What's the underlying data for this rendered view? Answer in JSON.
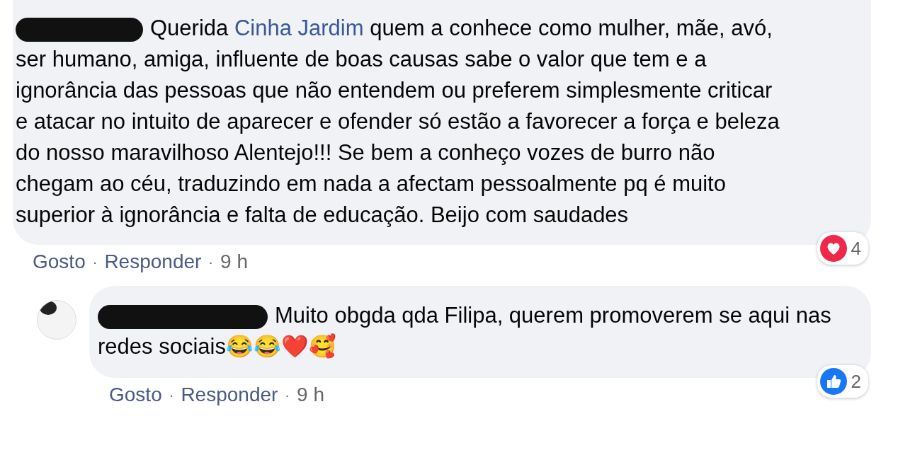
{
  "comments": [
    {
      "mention": "Cinha Jardim",
      "text_before": "Querida ",
      "text_after": " quem a conhece como mulher, mãe, avó, ser humano, amiga, influente de boas causas sabe o valor que tem e a ignorância das pessoas que não entendem ou preferem simplesmente criticar e atacar no intuito de aparecer e ofender só estão a favorecer a força e beleza do nosso maravilhoso Alentejo!!! Se bem a conheço vozes de burro não chegam ao céu, traduzindo em nada a afectam pessoalmente pq é muito superior à ignorância e falta de educação. Beijo com saudades",
      "reaction": {
        "kind": "love",
        "count": "4"
      },
      "actions": [
        {
          "kind": "link",
          "text": "Gosto"
        },
        {
          "kind": "separator",
          "text": "·"
        },
        {
          "kind": "link",
          "text": "Responder"
        },
        {
          "kind": "separator",
          "text": "·"
        },
        {
          "kind": "time",
          "text": "9 h"
        }
      ],
      "replies": [
        {
          "text_before": "Muito obgda qda Filipa, querem promoverem se aqui nas redes sociais😂😂❤️🥰",
          "reaction": {
            "kind": "like",
            "count": "2"
          },
          "actions": [
            {
              "kind": "link",
              "text": "Gosto"
            },
            {
              "kind": "separator",
              "text": "·"
            },
            {
              "kind": "link",
              "text": "Responder"
            },
            {
              "kind": "separator",
              "text": "·"
            },
            {
              "kind": "time",
              "text": "9 h"
            }
          ]
        }
      ]
    }
  ]
}
